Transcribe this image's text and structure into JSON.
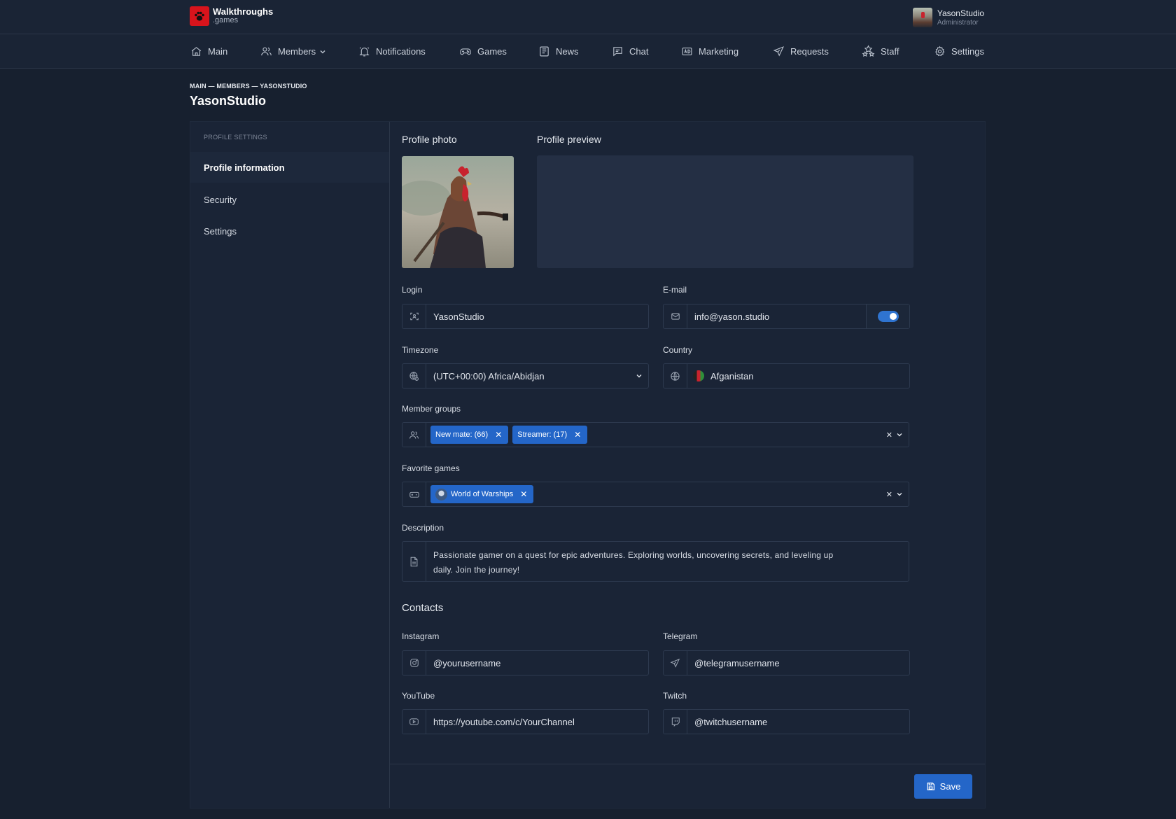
{
  "app": {
    "brand_title": "Walkthroughs",
    "brand_sub": ".games"
  },
  "user": {
    "name": "YasonStudio",
    "role": "Administrator"
  },
  "nav": {
    "main": "Main",
    "members": "Members",
    "notifications": "Notifications",
    "games": "Games",
    "news": "News",
    "chat": "Chat",
    "marketing": "Marketing",
    "requests": "Requests",
    "staff": "Staff",
    "settings": "Settings"
  },
  "breadcrumb": "MAIN — MEMBERS — YASONSTUDIO",
  "page_title": "YasonStudio",
  "sidebar": {
    "heading": "PROFILE SETTINGS",
    "items": [
      {
        "label": "Profile information",
        "active": true
      },
      {
        "label": "Security",
        "active": false
      },
      {
        "label": "Settings",
        "active": false
      }
    ]
  },
  "profile": {
    "photo_label": "Profile photo",
    "preview_label": "Profile preview",
    "login_label": "Login",
    "login_value": "YasonStudio",
    "email_label": "E-mail",
    "email_value": "info@yason.studio",
    "email_toggle_on": true,
    "timezone_label": "Timezone",
    "timezone_value": "(UTC+00:00) Africa/Abidjan",
    "country_label": "Country",
    "country_value": "Afganistan",
    "groups_label": "Member groups",
    "groups": [
      "New mate: (66)",
      "Streamer: (17)"
    ],
    "games_label": "Favorite games",
    "games": [
      "World of Warships"
    ],
    "description_label": "Description",
    "description_line1": "Passionate gamer on a quest for epic adventures. Exploring worlds, uncovering secrets, and leveling up",
    "description_line2": "daily. Join the journey!"
  },
  "contacts": {
    "title": "Contacts",
    "instagram_label": "Instagram",
    "instagram_value": "@yourusername",
    "telegram_label": "Telegram",
    "telegram_value": "@telegramusername",
    "youtube_label": "YouTube",
    "youtube_value": "https://youtube.com/c/YourChannel",
    "twitch_label": "Twitch",
    "twitch_value": "@twitchusername"
  },
  "save_label": "Save",
  "colors": {
    "accent": "#2466c8",
    "brand": "#d8141c",
    "background": "#17202f"
  }
}
